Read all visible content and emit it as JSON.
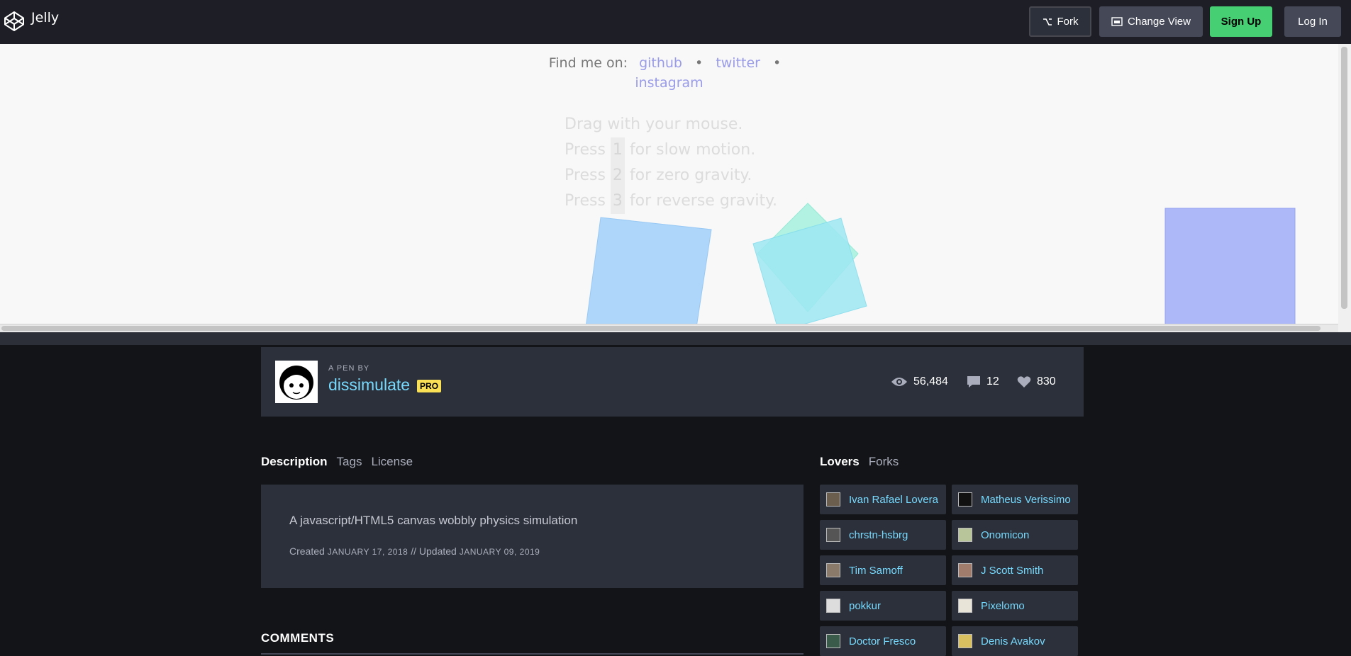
{
  "header": {
    "pen_title": "Jelly",
    "fork_label": "Fork",
    "change_view_label": "Change View",
    "signup_label": "Sign Up",
    "login_label": "Log In"
  },
  "preview": {
    "find_me_label": "Find me on:",
    "links": [
      "github",
      "twitter",
      "instagram"
    ],
    "separator": "•",
    "instructions": [
      {
        "pre": "Drag with your mouse.",
        "key": "",
        "post": ""
      },
      {
        "pre": "Press ",
        "key": "1",
        "post": " for slow motion."
      },
      {
        "pre": "Press ",
        "key": "2",
        "post": " for zero gravity."
      },
      {
        "pre": "Press ",
        "key": "3",
        "post": " for reverse gravity."
      }
    ]
  },
  "pen": {
    "by_label": "A PEN BY",
    "author": "dissimulate",
    "badge": "PRO",
    "views": "56,484",
    "comments": "12",
    "loves": "830"
  },
  "tabs": {
    "left": [
      "Description",
      "Tags",
      "License"
    ],
    "right": [
      "Lovers",
      "Forks"
    ]
  },
  "description": {
    "text": "A javascript/HTML5 canvas wobbly physics simulation",
    "created_label": "Created",
    "created_date": "January 17, 2018",
    "separator": "//",
    "updated_label": "Updated",
    "updated_date": "January 09, 2019"
  },
  "comments_heading": "COMMENTS",
  "lovers": [
    "Ivan Rafael Lovera",
    "Matheus Verissimo",
    "chrstn-hsbrg",
    "Onomicon",
    "Tim Samoff",
    "J Scott Smith",
    "pokkur",
    "Pixelomo",
    "Doctor Fresco",
    "Denis Avakov"
  ],
  "colors": {
    "accent_link": "#76daff",
    "signup_green": "#47cf73",
    "pro_badge": "#f9e054",
    "preview_link": "#9a9ce8"
  }
}
